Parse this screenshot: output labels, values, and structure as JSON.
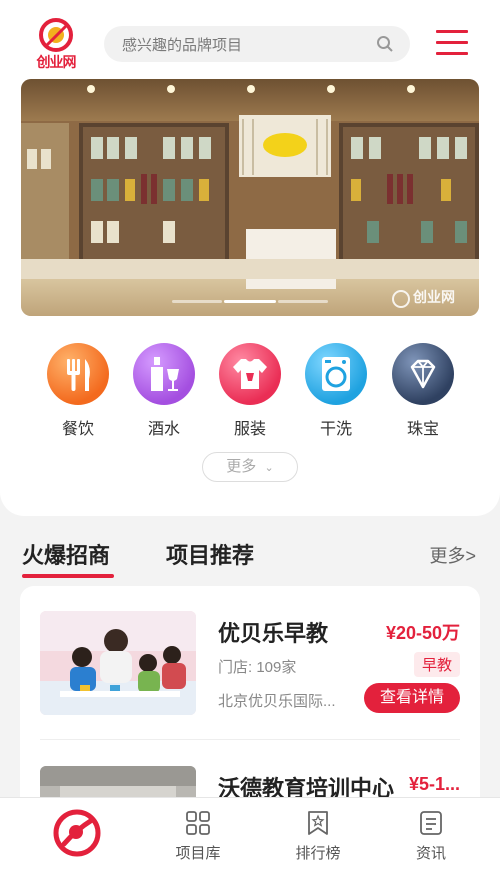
{
  "header": {
    "logo_text": "创业网",
    "search_placeholder": "感兴趣的品牌项目"
  },
  "banner": {
    "watermark": "创业网",
    "slide_count": 3,
    "active_slide": 2
  },
  "categories": [
    {
      "label": "餐饮",
      "icon": "fork-knife-icon",
      "color": "#f36a1e"
    },
    {
      "label": "酒水",
      "icon": "bottle-glass-icon",
      "color": "#a44fe0"
    },
    {
      "label": "服装",
      "icon": "tshirt-icon",
      "color": "#ea2e55"
    },
    {
      "label": "干洗",
      "icon": "washing-machine-icon",
      "color": "#1fa2e0"
    },
    {
      "label": "珠宝",
      "icon": "diamond-icon",
      "color": "#3a4d6b"
    }
  ],
  "more_button": {
    "label": "更多"
  },
  "tabs": {
    "items": [
      "火爆招商",
      "项目推荐"
    ],
    "active": 0,
    "more_label": "更多>"
  },
  "projects": [
    {
      "name": "优贝乐早教",
      "price": "¥20-50万",
      "stores": "门店: 109家",
      "tag": "早教",
      "company": "北京优贝乐国际...",
      "detail_label": "查看详情"
    },
    {
      "name": "沃德教育培训中心",
      "price": "¥5-1..."
    }
  ],
  "tabbar": {
    "items": [
      {
        "label": "项目库",
        "icon": "grid-icon"
      },
      {
        "label": "排行榜",
        "icon": "bookmark-star-icon"
      },
      {
        "label": "资讯",
        "icon": "document-icon"
      }
    ]
  },
  "colors": {
    "accent": "#e3213c"
  }
}
